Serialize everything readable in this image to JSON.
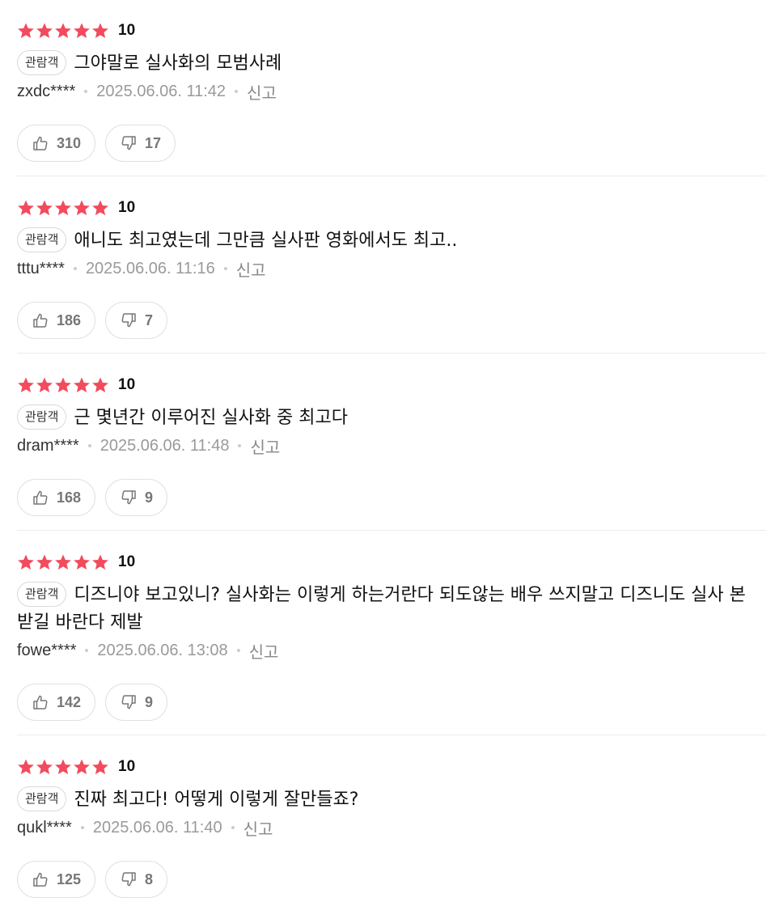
{
  "colors": {
    "star": "#f24b5e",
    "badge_border": "#d9d9d9",
    "meta_text": "#9a9a9a",
    "button_text": "#777777"
  },
  "icons": {
    "star": "star-icon",
    "like": "thumbs-up-icon",
    "dislike": "thumbs-down-icon"
  },
  "reviews": [
    {
      "stars": 5,
      "score": "10",
      "badge": "관람객",
      "text": "그야말로 실사화의 모범사례",
      "user": "zxdc****",
      "date": "2025.06.06. 11:42",
      "report": "신고",
      "likes": "310",
      "dislikes": "17"
    },
    {
      "stars": 5,
      "score": "10",
      "badge": "관람객",
      "text": "애니도 최고였는데 그만큼 실사판 영화에서도 최고..",
      "user": "tttu****",
      "date": "2025.06.06. 11:16",
      "report": "신고",
      "likes": "186",
      "dislikes": "7"
    },
    {
      "stars": 5,
      "score": "10",
      "badge": "관람객",
      "text": "근 몇년간 이루어진 실사화 중 최고다",
      "user": "dram****",
      "date": "2025.06.06. 11:48",
      "report": "신고",
      "likes": "168",
      "dislikes": "9"
    },
    {
      "stars": 5,
      "score": "10",
      "badge": "관람객",
      "text": "디즈니야 보고있니? 실사화는 이렇게 하는거란다 되도않는 배우 쓰지말고 디즈니도 실사 본받길 바란다 제발",
      "user": "fowe****",
      "date": "2025.06.06. 13:08",
      "report": "신고",
      "likes": "142",
      "dislikes": "9"
    },
    {
      "stars": 5,
      "score": "10",
      "badge": "관람객",
      "text": "진짜 최고다! 어떻게 이렇게 잘만들죠?",
      "user": "qukl****",
      "date": "2025.06.06. 11:40",
      "report": "신고",
      "likes": "125",
      "dislikes": "8"
    }
  ]
}
